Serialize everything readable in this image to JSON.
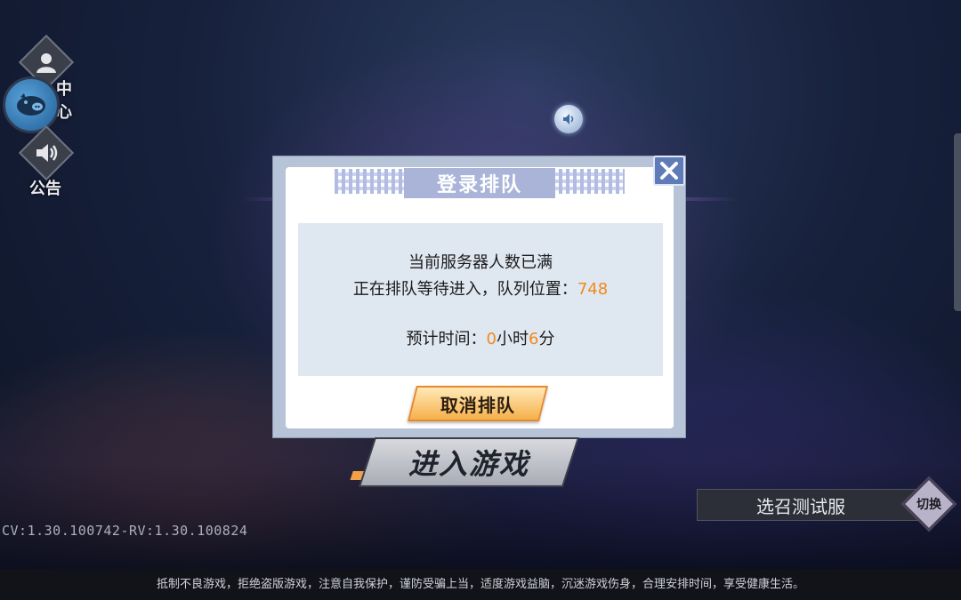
{
  "sidebar": {
    "center_label": "中心",
    "notice_label": "公告"
  },
  "queue_dialog": {
    "title": "登录排队",
    "line1": "当前服务器人数已满",
    "line2_prefix": "正在排队等待进入，队列位置：",
    "queue_position": "748",
    "eta_prefix": "预计时间：",
    "eta_hours": "0",
    "eta_hours_unit": "小时",
    "eta_minutes": "6",
    "eta_minutes_unit": "分",
    "cancel_label": "取消排队"
  },
  "enter_game_label": "进入游戏",
  "server": {
    "name": "选召测试服",
    "switch_label": "切换"
  },
  "version_text": "CV:1.30.100742-RV:1.30.100824",
  "footer_text": "抵制不良游戏，拒绝盗版游戏，注意自我保护，谨防受骗上当，适度游戏益脑，沉迷游戏伤身，合理安排时间，享受健康生活。",
  "colors": {
    "highlight": "#f08a1c",
    "dialog_frame": "#b7c3d6",
    "close_button": "#5f7bb8"
  },
  "icons": [
    "user-icon",
    "pig-avatar-icon",
    "speaker-icon",
    "sound-toggle-icon",
    "close-icon"
  ]
}
